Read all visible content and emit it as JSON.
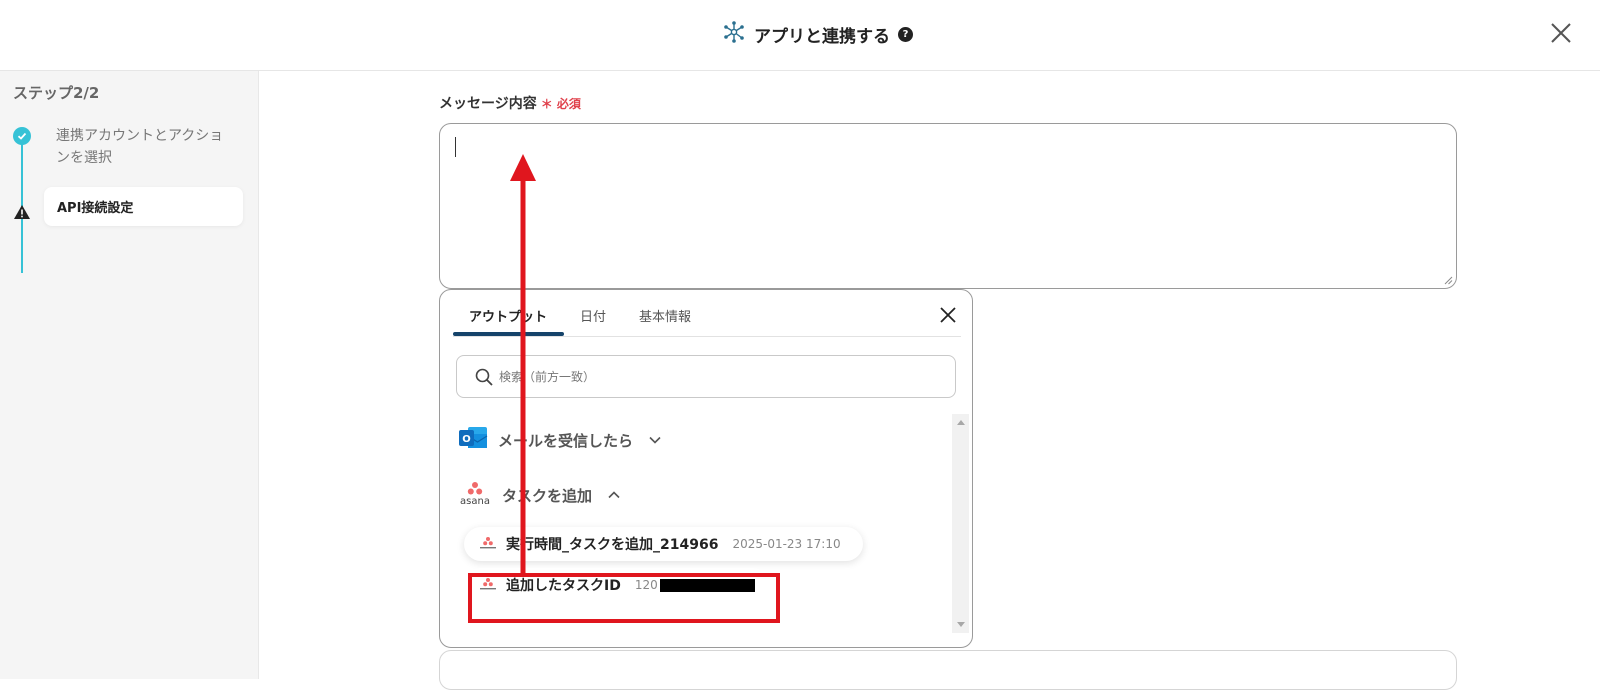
{
  "header": {
    "title": "アプリと連携する",
    "help_icon": "?"
  },
  "sidebar": {
    "step_label": "ステップ2/2",
    "steps": [
      {
        "label": "連携アカウントとアクションを選択",
        "status": "complete",
        "color": "#36c2d6"
      },
      {
        "label": "API接続設定",
        "status": "warning"
      }
    ]
  },
  "field": {
    "label": "メッセージ内容",
    "required_label": "＊ 必須"
  },
  "popup": {
    "tabs": [
      {
        "label": "アウトプット"
      },
      {
        "label": "日付"
      },
      {
        "label": "基本情報"
      }
    ],
    "search_placeholder": "検索（前方一致）",
    "groups": [
      {
        "label": "メールを受信したら",
        "icon": "outlook-icon",
        "expanded": false
      },
      {
        "label": "タスクを追加",
        "icon": "asana-icon",
        "expanded": true
      }
    ],
    "items": [
      {
        "label": "実行時間_タスクを追加_214966",
        "value": "2025-01-23 17:10"
      },
      {
        "label": "追加したタスクID",
        "value": "120"
      }
    ],
    "asana_logo_text": "asana"
  },
  "annotation": {
    "color": "#e0161e"
  }
}
